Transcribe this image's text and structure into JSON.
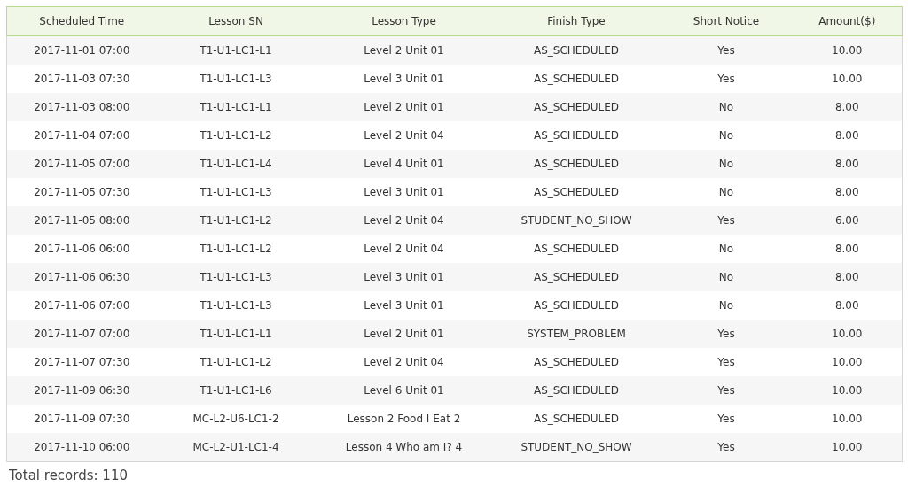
{
  "table": {
    "columns": [
      "Scheduled Time",
      "Lesson SN",
      "Lesson Type",
      "Finish Type",
      "Short Notice",
      "Amount($)"
    ],
    "rows": [
      [
        "2017-11-01 07:00",
        "T1-U1-LC1-L1",
        "Level 2 Unit 01",
        "AS_SCHEDULED",
        "Yes",
        "10.00"
      ],
      [
        "2017-11-03 07:30",
        "T1-U1-LC1-L3",
        "Level 3 Unit 01",
        "AS_SCHEDULED",
        "Yes",
        "10.00"
      ],
      [
        "2017-11-03 08:00",
        "T1-U1-LC1-L1",
        "Level 2 Unit 01",
        "AS_SCHEDULED",
        "No",
        "8.00"
      ],
      [
        "2017-11-04 07:00",
        "T1-U1-LC1-L2",
        "Level 2 Unit 04",
        "AS_SCHEDULED",
        "No",
        "8.00"
      ],
      [
        "2017-11-05 07:00",
        "T1-U1-LC1-L4",
        "Level 4 Unit 01",
        "AS_SCHEDULED",
        "No",
        "8.00"
      ],
      [
        "2017-11-05 07:30",
        "T1-U1-LC1-L3",
        "Level 3 Unit 01",
        "AS_SCHEDULED",
        "No",
        "8.00"
      ],
      [
        "2017-11-05 08:00",
        "T1-U1-LC1-L2",
        "Level 2 Unit 04",
        "STUDENT_NO_SHOW",
        "Yes",
        "6.00"
      ],
      [
        "2017-11-06 06:00",
        "T1-U1-LC1-L2",
        "Level 2 Unit 04",
        "AS_SCHEDULED",
        "No",
        "8.00"
      ],
      [
        "2017-11-06 06:30",
        "T1-U1-LC1-L3",
        "Level 3 Unit 01",
        "AS_SCHEDULED",
        "No",
        "8.00"
      ],
      [
        "2017-11-06 07:00",
        "T1-U1-LC1-L3",
        "Level 3 Unit 01",
        "AS_SCHEDULED",
        "No",
        "8.00"
      ],
      [
        "2017-11-07 07:00",
        "T1-U1-LC1-L1",
        "Level 2 Unit 01",
        "SYSTEM_PROBLEM",
        "Yes",
        "10.00"
      ],
      [
        "2017-11-07 07:30",
        "T1-U1-LC1-L2",
        "Level 2 Unit 04",
        "AS_SCHEDULED",
        "Yes",
        "10.00"
      ],
      [
        "2017-11-09 06:30",
        "T1-U1-LC1-L6",
        "Level 6 Unit 01",
        "AS_SCHEDULED",
        "Yes",
        "10.00"
      ],
      [
        "2017-11-09 07:30",
        "MC-L2-U6-LC1-2",
        "Lesson 2 Food I Eat 2",
        "AS_SCHEDULED",
        "Yes",
        "10.00"
      ],
      [
        "2017-11-10 06:00",
        "MC-L2-U1-LC1-4",
        "Lesson 4 Who am I? 4",
        "STUDENT_NO_SHOW",
        "Yes",
        "10.00"
      ]
    ]
  },
  "total_records": "Total records: 110"
}
